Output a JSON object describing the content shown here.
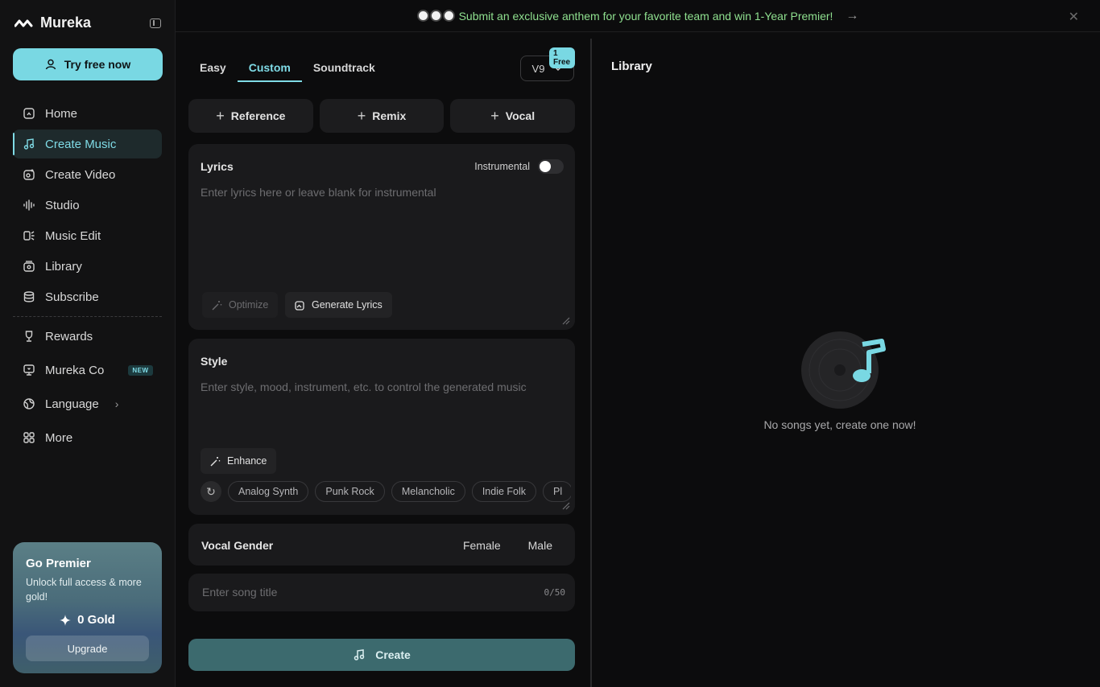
{
  "app": {
    "name": "Mureka"
  },
  "sidebar": {
    "try_button": "Try free now",
    "items": [
      {
        "label": "Home"
      },
      {
        "label": "Create Music"
      },
      {
        "label": "Create Video"
      },
      {
        "label": "Studio"
      },
      {
        "label": "Music Edit"
      },
      {
        "label": "Library"
      },
      {
        "label": "Subscribe"
      }
    ],
    "extra_items": [
      {
        "label": "Rewards"
      },
      {
        "label": "Mureka Co",
        "badge": "NEW"
      },
      {
        "label": "Language"
      },
      {
        "label": "More"
      }
    ],
    "premier": {
      "title": "Go Premier",
      "subtitle": "Unlock full access & more gold!",
      "gold": "0 Gold",
      "upgrade": "Upgrade"
    }
  },
  "banner": {
    "text": "Submit an exclusive anthem for your favorite team and win 1-Year Premier!"
  },
  "create": {
    "tabs": [
      "Easy",
      "Custom",
      "Soundtrack"
    ],
    "version": "V9",
    "free_badge": "1 Free",
    "add_buttons": [
      "Reference",
      "Remix",
      "Vocal"
    ],
    "lyrics": {
      "title": "Lyrics",
      "instrumental_label": "Instrumental",
      "placeholder": "Enter lyrics here or leave blank for instrumental",
      "optimize": "Optimize",
      "generate": "Generate Lyrics"
    },
    "style": {
      "title": "Style",
      "placeholder": "Enter style, mood, instrument, etc. to control the generated music",
      "enhance": "Enhance",
      "tags": [
        "Analog Synth",
        "Punk Rock",
        "Melancholic",
        "Indie Folk",
        "Pl"
      ]
    },
    "vocal_gender": {
      "title": "Vocal Gender",
      "options": [
        "Female",
        "Male"
      ]
    },
    "song_title": {
      "placeholder": "Enter song title",
      "counter": "0/50"
    },
    "create_button": "Create"
  },
  "library": {
    "title": "Library",
    "empty_text": "No songs yet, create one now!"
  },
  "colors": {
    "accent": "#79d8e3",
    "banner_text": "#8fe08f",
    "create_button": "#3c6a6e"
  }
}
